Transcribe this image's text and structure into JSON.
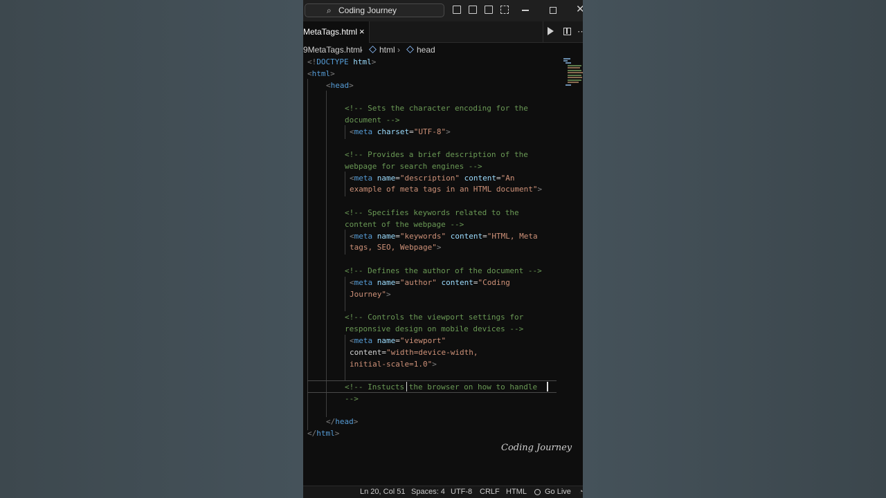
{
  "window": {
    "search_text": "Coding Journey",
    "search_icon": "search-icon"
  },
  "tab": {
    "label": "MetaTags.html",
    "close": "×"
  },
  "breadcrumbs": [
    "9MetaTags.html",
    "html",
    "head"
  ],
  "code": {
    "doctype_open": "<!",
    "doctype_kw": "DOCTYPE",
    "doctype_rest": "html",
    "doctype_close": ">",
    "html_open": "html",
    "head_open": "head",
    "comment1_a": "<!-- Sets the character encoding for the",
    "comment1_b": "document -->",
    "meta1_attr": "charset",
    "meta1_val": "\"UTF-8\"",
    "comment2_a": "<!-- Provides a brief description of the",
    "comment2_b": "webpage for search engines -->",
    "meta2_name_val": "\"description\"",
    "meta2_content_a": "\"An",
    "meta2_content_b": "example of meta tags in an HTML document\"",
    "comment3_a": "<!-- Specifies keywords related to the",
    "comment3_b": "content of the webpage -->",
    "meta3_name_val": "\"keywords\"",
    "meta3_content_a": "\"HTML, Meta",
    "meta3_content_b": "tags, SEO, Webpage\"",
    "comment4": "<!-- Defines the author of the document -->",
    "meta4_name_val": "\"author\"",
    "meta4_content_a": "\"Coding",
    "meta4_content_b": "Journey\"",
    "comment5_a": "<!-- Controls the viewport settings for",
    "comment5_b": "responsive design on mobile devices -->",
    "meta5_name_val": "\"viewport\"",
    "meta5_content_a": "\"width=device-width,",
    "meta5_content_b": "initial-scale=1.0\"",
    "comment6_a": "<!-- Instucts the browser on how to handle",
    "comment6_b": "-->",
    "head_close": "head",
    "html_close": "html",
    "kw_meta": "meta",
    "kw_name": "name",
    "kw_content": "content"
  },
  "watermark": "Coding Journey",
  "status": {
    "position": "Ln 20, Col 51",
    "spaces": "Spaces: 4",
    "encoding": "UTF-8",
    "eol": "CRLF",
    "language": "HTML",
    "golive": "Go Live"
  }
}
